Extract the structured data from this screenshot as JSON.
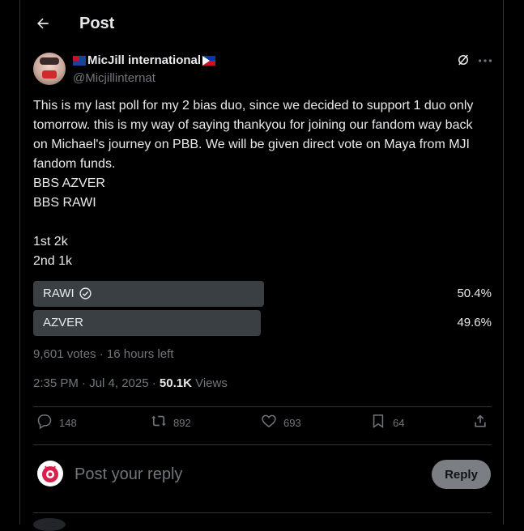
{
  "header": {
    "title": "Post"
  },
  "author": {
    "display_name": "MicJill international",
    "handle": "@Micjillinternat"
  },
  "post": {
    "text": "This is my last poll for my 2 bias duo, since we decided to support 1 duo only tomorrow. this is my way of saying thankyou for joining our fandom way back on Michael's journey on PBB. We will be given direct vote on Maya from MJI fandom funds.\nBBS AZVER\nBBS RAWI\n\n1st 2k\n2nd 1k"
  },
  "poll": {
    "options": [
      {
        "label": "RAWI",
        "percent_text": "50.4%",
        "percent": 50.4,
        "winner": true
      },
      {
        "label": "AZVER",
        "percent_text": "49.6%",
        "percent": 49.6,
        "winner": false
      }
    ],
    "summary": "9,601 votes · 16 hours left"
  },
  "timestamp": {
    "time": "2:35 PM · Jul 4, 2025 · ",
    "views_count": "50.1K",
    "views_label": " Views"
  },
  "actions": {
    "replies": "148",
    "reposts": "892",
    "likes": "693",
    "bookmarks": "64"
  },
  "reply_box": {
    "placeholder": "Post your reply",
    "button": "Reply"
  },
  "colors": {
    "background": "#000000",
    "text": "#e7e9ea",
    "muted": "#71767b",
    "poll_bar": "#3a3f44",
    "reply_button": "#7b7f83"
  },
  "icons": [
    "back-arrow-icon",
    "grok-icon",
    "more-icon",
    "check-circle-icon",
    "reply-icon",
    "repost-icon",
    "like-icon",
    "bookmark-icon",
    "share-icon"
  ]
}
